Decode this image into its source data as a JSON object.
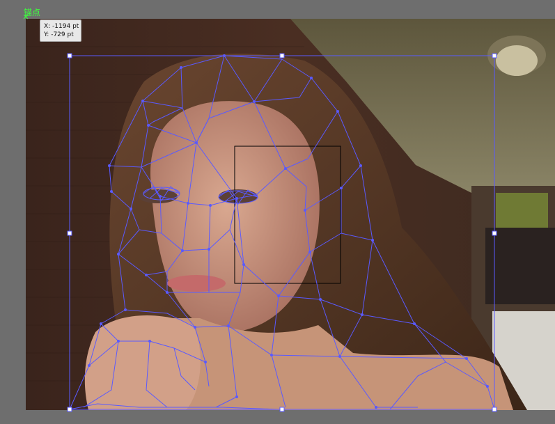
{
  "anchor": {
    "label": "锚点",
    "icon": "anchor-point-icon",
    "color": "#3dff3d"
  },
  "tooltip": {
    "x_label": "X: -1194 pt",
    "y_label": "Y: -729 pt"
  },
  "colors": {
    "canvas": "#6e6e6e",
    "mesh_stroke": "#5a5aff",
    "selection_box": "#000000"
  }
}
